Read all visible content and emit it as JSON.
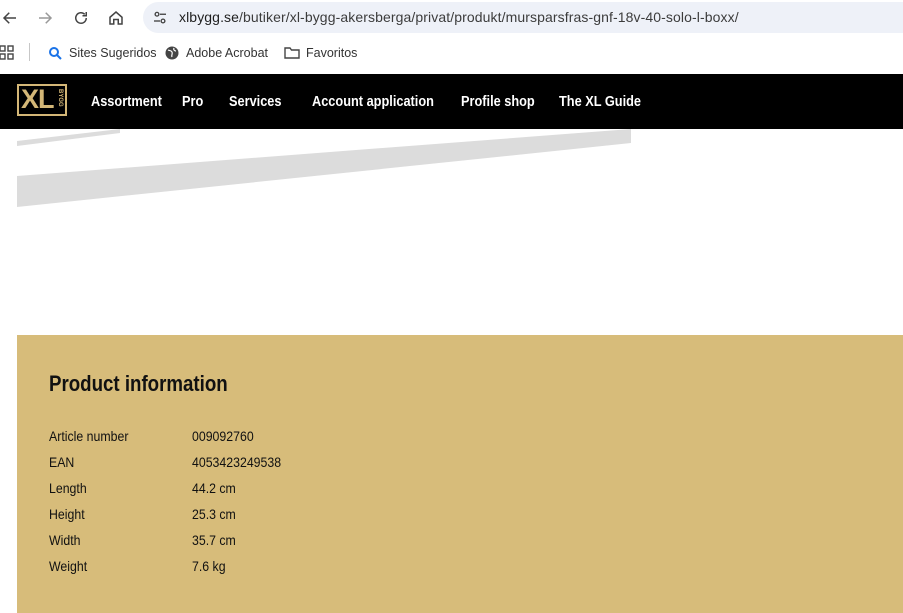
{
  "browser": {
    "url_host": "xlbygg.se",
    "url_path": "/butiker/xl-bygg-akersberga/privat/produkt/mursparsfras-gnf-18v-40-solo-l-boxx/",
    "bookmarks": [
      {
        "label": "Sites Sugeridos",
        "icon": "search-icon"
      },
      {
        "label": "Adobe Acrobat",
        "icon": "globe-icon"
      },
      {
        "label": "Favoritos",
        "icon": "folder-icon"
      }
    ]
  },
  "site": {
    "logo_text": "XL",
    "logo_subtext": "BYGG",
    "nav": [
      "Assortment",
      "Pro",
      "Services",
      "Account application",
      "Profile shop",
      "The XL Guide"
    ]
  },
  "product_info": {
    "title": "Product information",
    "rows": [
      {
        "label": "Article number",
        "value": "009092760"
      },
      {
        "label": "EAN",
        "value": "4053423249538"
      },
      {
        "label": "Length",
        "value": "44.2 cm"
      },
      {
        "label": "Height",
        "value": "25.3 cm"
      },
      {
        "label": "Width",
        "value": "35.7 cm"
      },
      {
        "label": "Weight",
        "value": "7.6 kg"
      }
    ]
  },
  "colors": {
    "header_bg": "#000000",
    "brand_gold": "#d4b777",
    "panel_bg": "#d7bc7a",
    "stripe": "#dcdcdc"
  }
}
